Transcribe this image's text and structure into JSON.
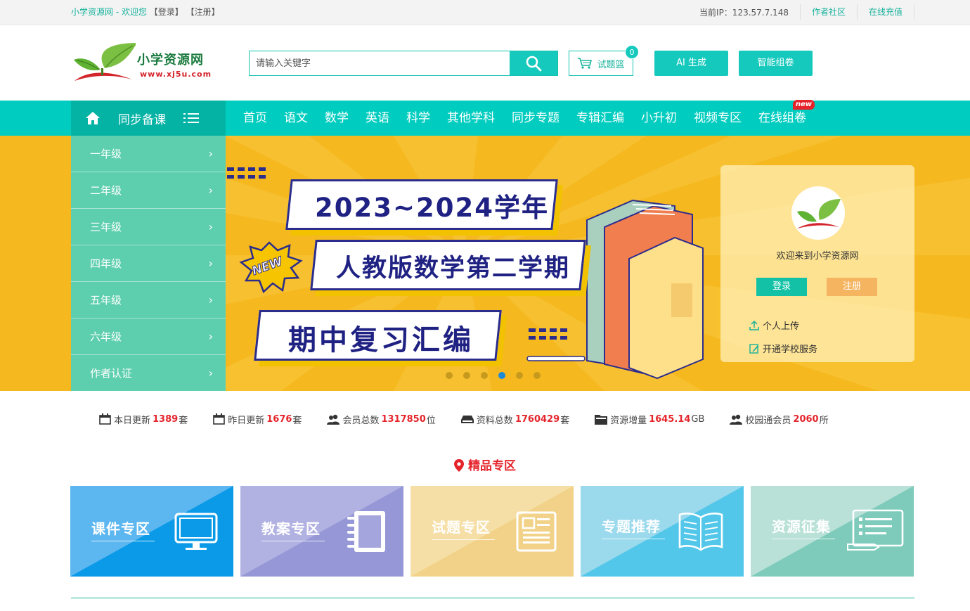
{
  "topbar": {
    "welcome": "小学资源网 - 欢迎您",
    "login": "【登录】",
    "register": "【注册】",
    "ip": "当前IP：123.57.7.148",
    "author_community": "作者社区",
    "recharge": "在线充值"
  },
  "header": {
    "logo_name": "小学资源网",
    "logo_url": "www.xj5u.com",
    "search_placeholder": "请输入关键字",
    "basket_label": "试题篮",
    "basket_count": "0",
    "ai_label": "AI 生成",
    "smart_label": "智能组卷"
  },
  "nav": {
    "sync_label": "同步备课",
    "items": [
      "首页",
      "语文",
      "数学",
      "英语",
      "科学",
      "其他学科",
      "同步专题",
      "专辑汇编",
      "小升初",
      "视频专区",
      "在线组卷"
    ],
    "new_badge": "new"
  },
  "grades": [
    "一年级",
    "二年级",
    "三年级",
    "四年级",
    "五年级",
    "六年级",
    "作者认证"
  ],
  "banner": {
    "line1": "2023~2024学年",
    "line2": "人教版数学第二学期",
    "line3": "期中复习汇编",
    "new_star": "NEW",
    "dots": 6,
    "active_dot": 4
  },
  "welcome_panel": {
    "text": "欢迎来到小学资源网",
    "login": "登录",
    "register": "注册",
    "upload": "个人上传",
    "school_service": "开通学校服务"
  },
  "stats": [
    {
      "label": "本日更新",
      "value": "1389",
      "unit": "套",
      "icon": "calendar-icon"
    },
    {
      "label": "昨日更新",
      "value": "1676",
      "unit": "套",
      "icon": "calendar-icon"
    },
    {
      "label": "会员总数",
      "value": "1317850",
      "unit": "位",
      "icon": "users-icon"
    },
    {
      "label": "资料总数",
      "value": "1760429",
      "unit": "套",
      "icon": "drive-icon"
    },
    {
      "label": "资源增量",
      "value": "1645.14",
      "unit": "GB",
      "icon": "folder-icon"
    },
    {
      "label": "校园通会员",
      "value": "2060",
      "unit": "所",
      "icon": "users-icon"
    }
  ],
  "premium": {
    "title": "精品专区",
    "cards": [
      "课件专区",
      "教案专区",
      "试题专区",
      "专题推荐",
      "资源征集"
    ]
  },
  "colors": {
    "teal": "#00cdbf",
    "teal_dark": "#05b3a5",
    "accent_red": "#e5252c",
    "banner_yellow": "#f5b81f"
  }
}
